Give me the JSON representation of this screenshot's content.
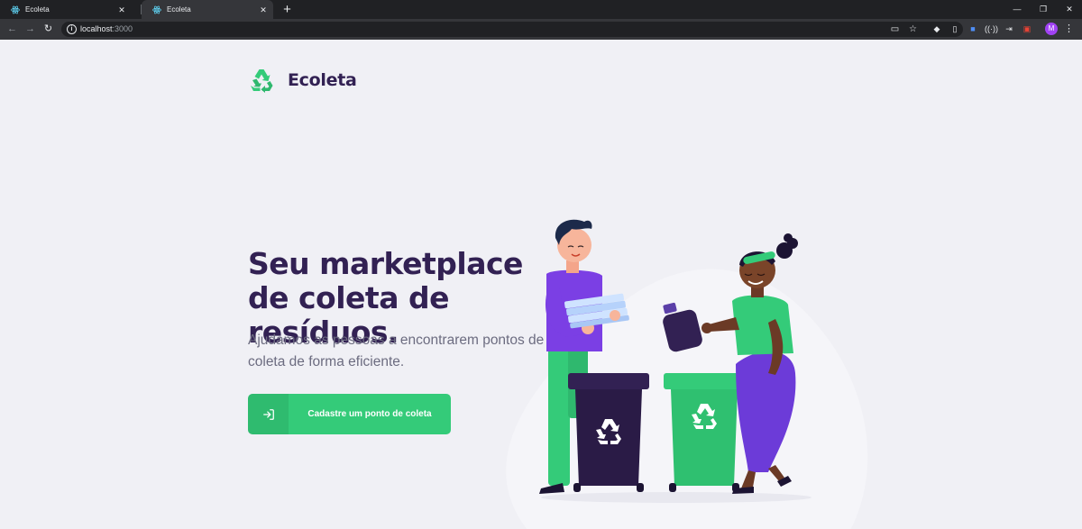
{
  "browser": {
    "tabs": [
      {
        "title": "Ecoleta",
        "active": false
      },
      {
        "title": "Ecoleta",
        "active": true
      }
    ],
    "new_tab_symbol": "+",
    "url_host": "localhost",
    "url_port": ":3000",
    "profile_initial": "M",
    "window_controls": [
      "minimize-icon",
      "restore-icon",
      "close-icon"
    ],
    "extensions": [
      "cast-icon",
      "star-icon",
      "extension-1-icon",
      "extension-2-icon",
      "extension-3-icon",
      "extension-4-icon",
      "extension-5-icon",
      "extension-6-icon"
    ]
  },
  "page": {
    "logo_text": "Ecoleta",
    "hero_title": "Seu marketplace de coleta de resíduos.",
    "hero_subtitle": "Ajudamos as pessoas a encontrarem pontos de coleta de forma eficiente.",
    "cta_label": "Cadastre um ponto de coleta"
  },
  "colors": {
    "primary": "#34cb79",
    "title": "#322153",
    "text": "#6c6c80",
    "background": "#f0f0f5",
    "bin_dark": "#322153",
    "person_purple": "#6c3bd8"
  }
}
